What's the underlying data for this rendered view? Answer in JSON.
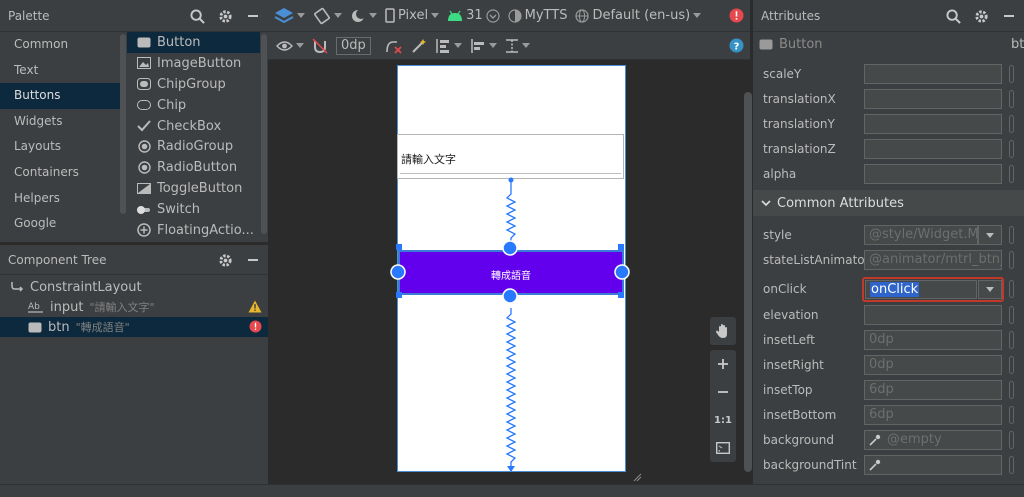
{
  "palette": {
    "title": "Palette",
    "categories": [
      "Common",
      "Text",
      "Buttons",
      "Widgets",
      "Layouts",
      "Containers",
      "Helpers",
      "Google"
    ],
    "selected_category": 2,
    "components": [
      {
        "label": "Button",
        "icon": "button-icon"
      },
      {
        "label": "ImageButton",
        "icon": "image-icon"
      },
      {
        "label": "ChipGroup",
        "icon": "chipgroup-icon"
      },
      {
        "label": "Chip",
        "icon": "chip-icon"
      },
      {
        "label": "CheckBox",
        "icon": "checkbox-icon"
      },
      {
        "label": "RadioGroup",
        "icon": "radio-icon"
      },
      {
        "label": "RadioButton",
        "icon": "radio-icon"
      },
      {
        "label": "ToggleButton",
        "icon": "toggle-icon"
      },
      {
        "label": "Switch",
        "icon": "switch-icon"
      },
      {
        "label": "FloatingActio...",
        "icon": "plus-circle-icon"
      }
    ]
  },
  "tree": {
    "title": "Component Tree",
    "root": "ConstraintLayout",
    "children": [
      {
        "name": "input",
        "hint": "\"請輸入文字\"",
        "icon": "textview-icon",
        "status": "warning"
      },
      {
        "name": "btn",
        "hint": "\"轉成語音\"",
        "icon": "button-icon",
        "status": "error"
      }
    ]
  },
  "toolbar": {
    "device": "Pixel",
    "api": "31",
    "theme": "MyTTS",
    "locale": "Default (en-us)",
    "margin": "0dp"
  },
  "canvas": {
    "input_text": "請輸入文字",
    "button_text": "轉成語音"
  },
  "zoom": {
    "fit_label": "1:1"
  },
  "attributes": {
    "title": "Attributes",
    "component": "Button",
    "component_id": "bt",
    "transform_rows": [
      {
        "key": "scaleY",
        "value": ""
      },
      {
        "key": "translationX",
        "value": ""
      },
      {
        "key": "translationY",
        "value": ""
      },
      {
        "key": "translationZ",
        "value": ""
      },
      {
        "key": "alpha",
        "value": ""
      }
    ],
    "section": "Common Attributes",
    "common_rows": [
      {
        "key": "style",
        "value": "@style/Widget.M",
        "dropdown": true
      },
      {
        "key": "stateListAnimator",
        "value": "@animator/mtrl_btn_s",
        "dropdown": false
      },
      {
        "key": "onClick",
        "value": "onClick",
        "dropdown": true,
        "focused": true
      },
      {
        "key": "elevation",
        "value": ""
      },
      {
        "key": "insetLeft",
        "value": "0dp"
      },
      {
        "key": "insetRight",
        "value": "0dp"
      },
      {
        "key": "insetTop",
        "value": "6dp"
      },
      {
        "key": "insetBottom",
        "value": "6dp"
      },
      {
        "key": "background",
        "value": "@empty",
        "picker": true
      },
      {
        "key": "backgroundTint",
        "value": "",
        "picker": true
      }
    ]
  },
  "colors": {
    "button_fill": "#6200ee",
    "selection_blue": "#4a8fd6",
    "error_red": "#e5484d",
    "warning_yellow": "#e8b62c",
    "focus_border": "#c0392b"
  }
}
